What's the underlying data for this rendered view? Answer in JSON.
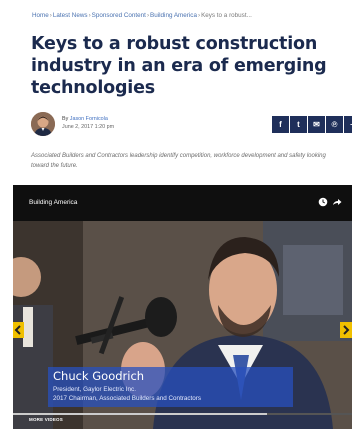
{
  "breadcrumb": {
    "items": [
      "Home",
      "Latest News",
      "Sponsored Content",
      "Building America"
    ],
    "current": "Keys to a robust...",
    "separator": "›"
  },
  "article": {
    "title": "Keys to a robust construction industry in an era of emerging technologies",
    "byline_prefix": "By",
    "author": "Jason Fornicola",
    "date": "June 2, 2017 1:20 pm",
    "summary": "Associated Builders and Contractors leadership identify competition, workforce development and safety looking toward the future."
  },
  "share_buttons": [
    {
      "label": "f",
      "icon": "facebook-icon"
    },
    {
      "label": "t",
      "icon": "twitter-icon"
    },
    {
      "label": "✉",
      "icon": "email-icon"
    },
    {
      "label": "℗",
      "icon": "pinterest-icon"
    },
    {
      "label": "+",
      "icon": "more-share-icon"
    }
  ],
  "video": {
    "channel": "Building America",
    "speaker_name": "Chuck Goodrich",
    "speaker_role_line1": "President, Gaylor Electric Inc.",
    "speaker_role_line2": "2017 Chairman, Associated Builders and Contractors",
    "more_videos_label": "MORE VIDEOS",
    "progress": 0.75
  },
  "colors": {
    "title": "#1b2a4e",
    "link": "#4a72b0",
    "share_bg": "#1f2f5a",
    "nav_arrow": "#f0c000",
    "lower_third": "#2850be"
  }
}
